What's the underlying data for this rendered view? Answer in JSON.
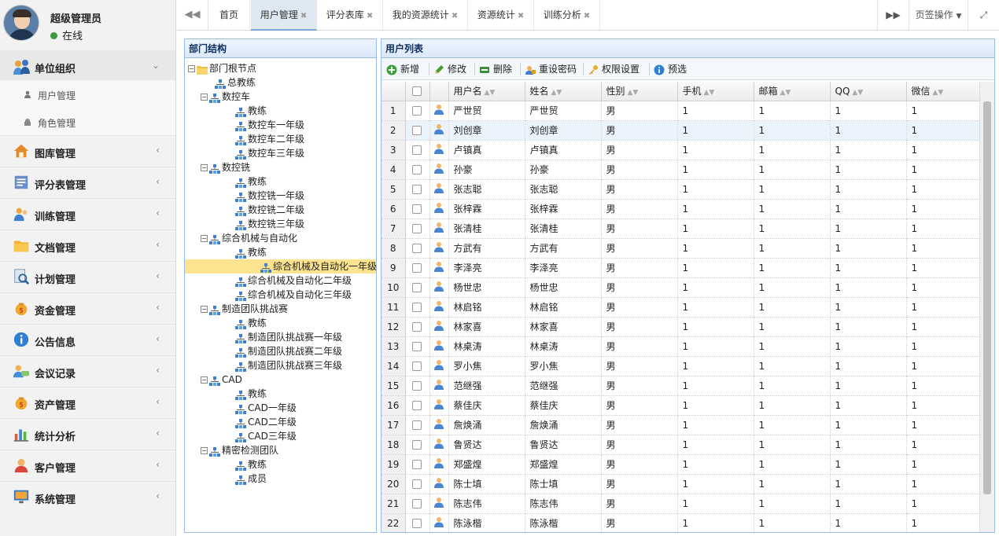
{
  "user": {
    "name": "超级管理员",
    "status": "在线"
  },
  "menu": [
    {
      "label": "单位组织",
      "icon": "people-group-icon",
      "expanded": true,
      "children": [
        {
          "label": "用户管理",
          "icon": "user-icon"
        },
        {
          "label": "角色管理",
          "icon": "role-icon"
        }
      ]
    },
    {
      "label": "图库管理",
      "icon": "house-icon"
    },
    {
      "label": "评分表管理",
      "icon": "form-icon"
    },
    {
      "label": "训练管理",
      "icon": "people-icon"
    },
    {
      "label": "文档管理",
      "icon": "folder-icon"
    },
    {
      "label": "计划管理",
      "icon": "magnifier-doc-icon"
    },
    {
      "label": "资金管理",
      "icon": "money-bag-icon"
    },
    {
      "label": "公告信息",
      "icon": "info-icon"
    },
    {
      "label": "会议记录",
      "icon": "meeting-icon"
    },
    {
      "label": "资产管理",
      "icon": "money-bag-icon"
    },
    {
      "label": "统计分析",
      "icon": "bar-chart-icon"
    },
    {
      "label": "客户管理",
      "icon": "customer-icon"
    },
    {
      "label": "系统管理",
      "icon": "monitor-icon"
    }
  ],
  "tabs": [
    "首页",
    "用户管理",
    "评分表库",
    "我的资源统计",
    "资源统计",
    "训练分析"
  ],
  "active_tab": 1,
  "tab_ops": "页签操作",
  "dept_panel": {
    "title": "部门结构"
  },
  "tree": [
    {
      "label": "部门根节点",
      "level": 0,
      "type": "folder"
    },
    {
      "label": "总教练",
      "level": 1,
      "type": "leaf"
    },
    {
      "label": "数控车",
      "level": 1,
      "type": "group"
    },
    {
      "label": "教练",
      "level": 2,
      "type": "leaf"
    },
    {
      "label": "数控车一年级",
      "level": 2,
      "type": "leaf"
    },
    {
      "label": "数控车二年级",
      "level": 2,
      "type": "leaf"
    },
    {
      "label": "数控车三年级",
      "level": 2,
      "type": "leaf"
    },
    {
      "label": "数控铣",
      "level": 1,
      "type": "group"
    },
    {
      "label": "教练",
      "level": 2,
      "type": "leaf"
    },
    {
      "label": "数控铣一年级",
      "level": 2,
      "type": "leaf"
    },
    {
      "label": "数控铣二年级",
      "level": 2,
      "type": "leaf"
    },
    {
      "label": "数控铣三年级",
      "level": 2,
      "type": "leaf"
    },
    {
      "label": "综合机械与自动化",
      "level": 1,
      "type": "group"
    },
    {
      "label": "教练",
      "level": 2,
      "type": "leaf"
    },
    {
      "label": "综合机械及自动化一年级",
      "level": 2,
      "type": "leaf",
      "selected": true
    },
    {
      "label": "综合机械及自动化二年级",
      "level": 2,
      "type": "leaf"
    },
    {
      "label": "综合机械及自动化三年级",
      "level": 2,
      "type": "leaf"
    },
    {
      "label": "制造团队挑战赛",
      "level": 1,
      "type": "group"
    },
    {
      "label": "教练",
      "level": 2,
      "type": "leaf"
    },
    {
      "label": "制造团队挑战赛一年级",
      "level": 2,
      "type": "leaf"
    },
    {
      "label": "制造团队挑战赛二年级",
      "level": 2,
      "type": "leaf"
    },
    {
      "label": "制造团队挑战赛三年级",
      "level": 2,
      "type": "leaf"
    },
    {
      "label": "CAD",
      "level": 1,
      "type": "group"
    },
    {
      "label": "教练",
      "level": 2,
      "type": "leaf"
    },
    {
      "label": "CAD一年级",
      "level": 2,
      "type": "leaf"
    },
    {
      "label": "CAD二年级",
      "level": 2,
      "type": "leaf"
    },
    {
      "label": "CAD三年级",
      "level": 2,
      "type": "leaf"
    },
    {
      "label": "精密检测团队",
      "level": 1,
      "type": "group"
    },
    {
      "label": "教练",
      "level": 2,
      "type": "leaf"
    },
    {
      "label": "成员",
      "level": 2,
      "type": "leaf"
    }
  ],
  "users_panel": {
    "title": "用户列表"
  },
  "toolbar": [
    {
      "label": "新增",
      "icon": "add-icon"
    },
    {
      "label": "修改",
      "icon": "pencil-icon"
    },
    {
      "label": "删除",
      "icon": "delete-icon"
    },
    {
      "label": "重设密码",
      "icon": "reset-password-icon"
    },
    {
      "label": "权限设置",
      "icon": "key-icon"
    },
    {
      "label": "预选",
      "icon": "info-icon"
    }
  ],
  "columns": [
    "用户名",
    "姓名",
    "性别",
    "手机",
    "邮箱",
    "QQ",
    "微信"
  ],
  "rows": [
    [
      "严世贸",
      "严世贸",
      "男",
      "1",
      "1",
      "1",
      "1"
    ],
    [
      "刘创章",
      "刘创章",
      "男",
      "1",
      "1",
      "1",
      "1"
    ],
    [
      "卢镇真",
      "卢镇真",
      "男",
      "1",
      "1",
      "1",
      "1"
    ],
    [
      "孙豪",
      "孙豪",
      "男",
      "1",
      "1",
      "1",
      "1"
    ],
    [
      "张志聪",
      "张志聪",
      "男",
      "1",
      "1",
      "1",
      "1"
    ],
    [
      "张梓霖",
      "张梓霖",
      "男",
      "1",
      "1",
      "1",
      "1"
    ],
    [
      "张清桂",
      "张清桂",
      "男",
      "1",
      "1",
      "1",
      "1"
    ],
    [
      "方武有",
      "方武有",
      "男",
      "1",
      "1",
      "1",
      "1"
    ],
    [
      "李泽亮",
      "李泽亮",
      "男",
      "1",
      "1",
      "1",
      "1"
    ],
    [
      "杨世忠",
      "杨世忠",
      "男",
      "1",
      "1",
      "1",
      "1"
    ],
    [
      "林启铭",
      "林启铭",
      "男",
      "1",
      "1",
      "1",
      "1"
    ],
    [
      "林家喜",
      "林家喜",
      "男",
      "1",
      "1",
      "1",
      "1"
    ],
    [
      "林桌涛",
      "林桌涛",
      "男",
      "1",
      "1",
      "1",
      "1"
    ],
    [
      "罗小焦",
      "罗小焦",
      "男",
      "1",
      "1",
      "1",
      "1"
    ],
    [
      "范继强",
      "范继强",
      "男",
      "1",
      "1",
      "1",
      "1"
    ],
    [
      "蔡佳庆",
      "蔡佳庆",
      "男",
      "1",
      "1",
      "1",
      "1"
    ],
    [
      "詹焕涌",
      "詹焕涌",
      "男",
      "1",
      "1",
      "1",
      "1"
    ],
    [
      "鲁贤达",
      "鲁贤达",
      "男",
      "1",
      "1",
      "1",
      "1"
    ],
    [
      "郑盛煌",
      "郑盛煌",
      "男",
      "1",
      "1",
      "1",
      "1"
    ],
    [
      "陈士填",
      "陈士填",
      "男",
      "1",
      "1",
      "1",
      "1"
    ],
    [
      "陈志伟",
      "陈志伟",
      "男",
      "1",
      "1",
      "1",
      "1"
    ],
    [
      "陈泳楷",
      "陈泳楷",
      "男",
      "1",
      "1",
      "1",
      "1"
    ]
  ],
  "highlighted_row": 1
}
